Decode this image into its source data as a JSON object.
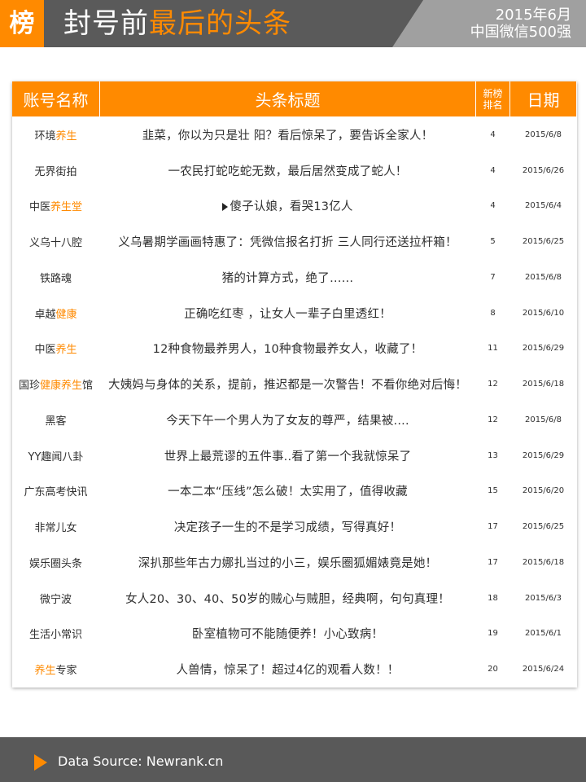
{
  "header": {
    "logo": "榜",
    "title_main": "封号前",
    "title_accent": "最后的头条",
    "date_line1": "2015年6月",
    "date_line2": "中国微信500强",
    "colors": {
      "accent": "#ff8a00",
      "dark": "#5a5a5a",
      "gray": "#a0a0a0"
    }
  },
  "table": {
    "columns": {
      "account": "账号名称",
      "headline": "头条标题",
      "rank_line1": "新榜",
      "rank_line2": "排名",
      "date": "日期"
    },
    "rows": [
      {
        "account_prefix": "环境",
        "account_highlight": "养生",
        "account_suffix": "",
        "headline": "韭菜，你以为只是壮 阳？看后惊呆了，要告诉全家人！",
        "rank": "4",
        "date": "2015/6/8"
      },
      {
        "account_prefix": "无界街拍",
        "account_highlight": "",
        "account_suffix": "",
        "headline": "一农民打蛇吃蛇无数，最后居然变成了蛇人！",
        "rank": "4",
        "date": "2015/6/26"
      },
      {
        "account_prefix": "中医",
        "account_highlight": "养生堂",
        "account_suffix": "",
        "headline": "傻子认娘，看哭13亿人",
        "rank": "4",
        "date": "2015/6/4",
        "headline_icon": "play-icon"
      },
      {
        "account_prefix": "义乌十八腔",
        "account_highlight": "",
        "account_suffix": "",
        "headline": "义乌暑期学画画特惠了：凭微信报名打折 三人同行还送拉杆箱！",
        "rank": "5",
        "date": "2015/6/25"
      },
      {
        "account_prefix": "铁路魂",
        "account_highlight": "",
        "account_suffix": "",
        "headline": "猪的计算方式，绝了……",
        "rank": "7",
        "date": "2015/6/8"
      },
      {
        "account_prefix": "卓越",
        "account_highlight": "健康",
        "account_suffix": "",
        "headline": "正确吃红枣 ，让女人一辈子白里透红！",
        "rank": "8",
        "date": "2015/6/10"
      },
      {
        "account_prefix": "中医",
        "account_highlight": "养生",
        "account_suffix": "",
        "headline": "12种食物最养男人，10种食物最养女人，收藏了！",
        "rank": "11",
        "date": "2015/6/29"
      },
      {
        "account_prefix": "国珍",
        "account_highlight": "健康养生",
        "account_suffix": "馆",
        "headline": "大姨妈与身体的关系，提前，推迟都是一次警告！不看你绝对后悔！",
        "rank": "12",
        "date": "2015/6/18"
      },
      {
        "account_prefix": "黑客",
        "account_highlight": "",
        "account_suffix": "",
        "headline": "今天下午一个男人为了女友的尊严，结果被....",
        "rank": "12",
        "date": "2015/6/8"
      },
      {
        "account_prefix": "YY趣闻八卦",
        "account_highlight": "",
        "account_suffix": "",
        "headline": "世界上最荒谬的五件事..看了第一个我就惊呆了",
        "rank": "13",
        "date": "2015/6/29"
      },
      {
        "account_prefix": "广东高考快讯",
        "account_highlight": "",
        "account_suffix": "",
        "headline": "一本二本“压线”怎么破！太实用了，值得收藏",
        "rank": "15",
        "date": "2015/6/20"
      },
      {
        "account_prefix": "非常儿女",
        "account_highlight": "",
        "account_suffix": "",
        "headline": "决定孩子一生的不是学习成绩，写得真好！",
        "rank": "17",
        "date": "2015/6/25"
      },
      {
        "account_prefix": "娱乐圈头条",
        "account_highlight": "",
        "account_suffix": "",
        "headline": "深扒那些年古力娜扎当过的小三，娱乐圈狐媚婊竟是她！",
        "rank": "17",
        "date": "2015/6/18"
      },
      {
        "account_prefix": "微宁波",
        "account_highlight": "",
        "account_suffix": "",
        "headline": "女人20、30、40、50岁的贼心与贼胆，经典啊，句句真理！",
        "rank": "18",
        "date": "2015/6/3"
      },
      {
        "account_prefix": "生活小常识",
        "account_highlight": "",
        "account_suffix": "",
        "headline": "卧室植物可不能随便养！小心致病！",
        "rank": "19",
        "date": "2015/6/1"
      },
      {
        "account_prefix": "",
        "account_highlight": "养生",
        "account_suffix": "专家",
        "headline": "人兽情，惊呆了！超过4亿的观看人数！！",
        "rank": "20",
        "date": "2015/6/24"
      }
    ]
  },
  "footer": {
    "text": "Data Source: Newrank.cn"
  }
}
